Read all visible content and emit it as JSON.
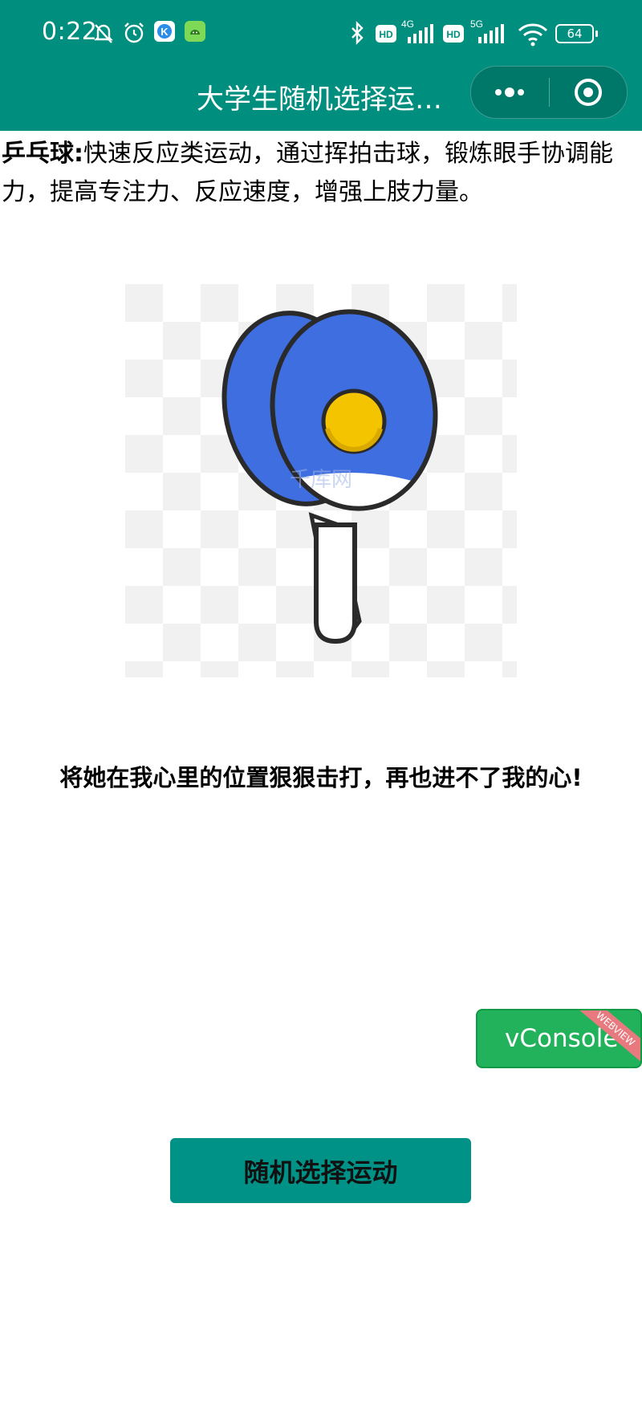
{
  "status_bar": {
    "time": "0:22",
    "battery": "64",
    "icons": [
      "mute-bell-icon",
      "alarm-icon",
      "k-app-icon",
      "android-app-icon",
      "bluetooth-icon",
      "hd-icon",
      "4g-signal-icon",
      "hd-icon",
      "5g-signal-icon",
      "wifi-icon",
      "battery-icon"
    ]
  },
  "nav": {
    "title": "大学生随机选择运…",
    "more_icon": "more-dots-icon",
    "close_icon": "target-icon"
  },
  "sport": {
    "name_label": "乒乓球:",
    "description": "快速反应类运动，通过挥拍击球，锻炼眼手协调能力，提高专注力、反应速度，增强上肢力量。",
    "image_icon": "ping-pong-paddles-icon",
    "watermark": "千库网",
    "tagline": "将她在我心里的位置狠狠击打，再也进不了我的心!"
  },
  "vconsole": {
    "label": "vConsole",
    "ribbon": "WEBVIEW"
  },
  "action": {
    "button_label": "随机选择运动"
  },
  "colors": {
    "header": "#008f7e",
    "button": "#009286",
    "vconsole": "#22b25c",
    "paddle_blue": "#3f6ee0",
    "ball_yellow": "#f5c400"
  }
}
